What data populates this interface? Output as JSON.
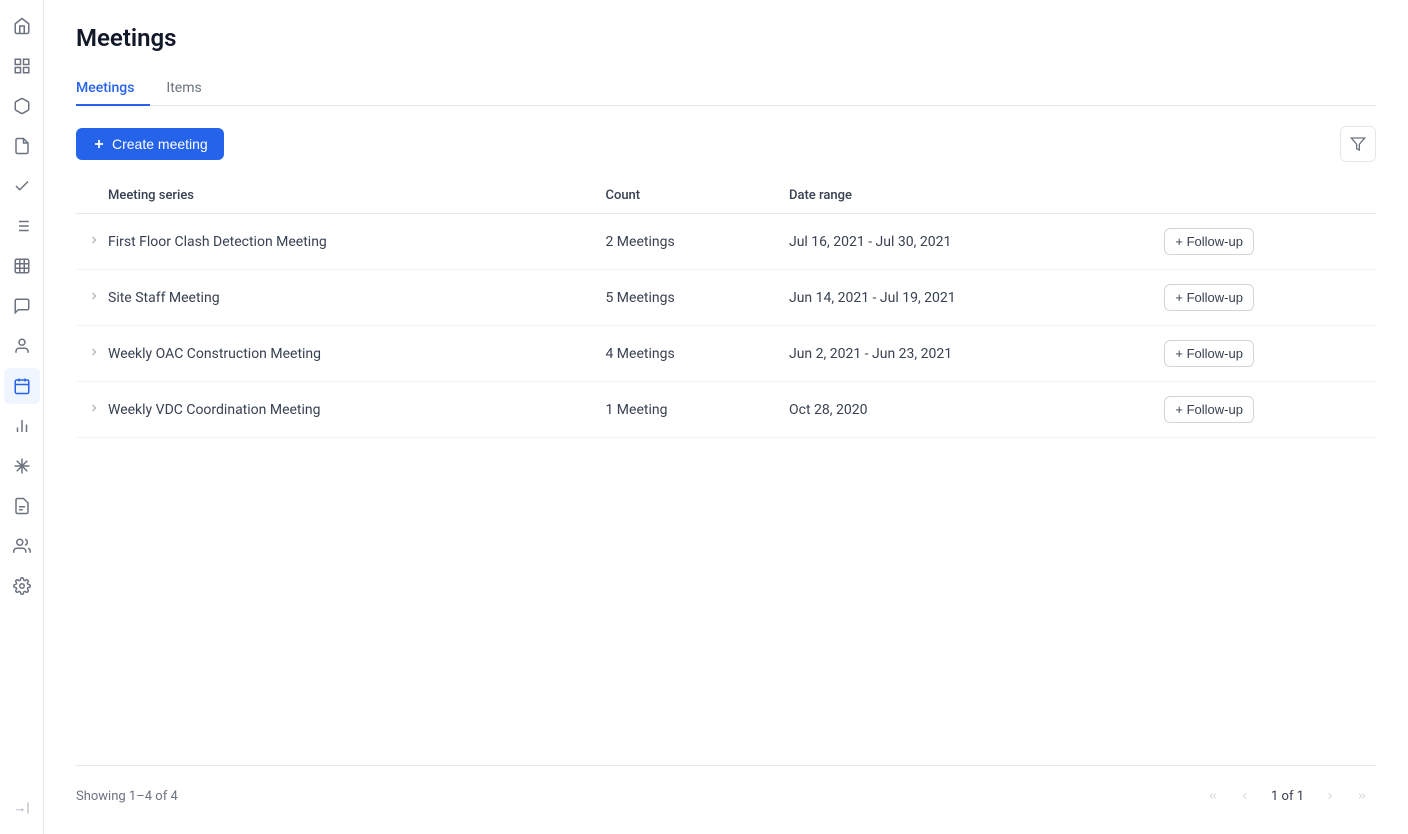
{
  "page": {
    "title": "Meetings"
  },
  "sidebar": {
    "icons": [
      {
        "name": "home-icon",
        "symbol": "⌂",
        "active": false
      },
      {
        "name": "grid-icon",
        "symbol": "⊞",
        "active": false
      },
      {
        "name": "box-icon",
        "symbol": "◻",
        "active": false
      },
      {
        "name": "document-icon",
        "symbol": "🗋",
        "active": false
      },
      {
        "name": "check-icon",
        "symbol": "✓",
        "active": false
      },
      {
        "name": "list-icon",
        "symbol": "☰",
        "active": false
      },
      {
        "name": "chart-icon",
        "symbol": "▦",
        "active": false
      },
      {
        "name": "comment-icon",
        "symbol": "💬",
        "active": false
      },
      {
        "name": "person-icon",
        "symbol": "👤",
        "active": false
      },
      {
        "name": "calendar-icon",
        "symbol": "📅",
        "active": true
      },
      {
        "name": "analytics-icon",
        "symbol": "📈",
        "active": false
      },
      {
        "name": "snowflake-icon",
        "symbol": "❄",
        "active": false
      },
      {
        "name": "reports-icon",
        "symbol": "📊",
        "active": false
      },
      {
        "name": "team-icon",
        "symbol": "👥",
        "active": false
      },
      {
        "name": "settings-icon",
        "symbol": "⚙",
        "active": false
      }
    ],
    "bottom_icon": {
      "name": "collapse-icon",
      "symbol": "→|"
    }
  },
  "tabs": [
    {
      "label": "Meetings",
      "active": true
    },
    {
      "label": "Items",
      "active": false
    }
  ],
  "toolbar": {
    "create_button_label": "Create meeting",
    "filter_button_label": "Filter"
  },
  "table": {
    "columns": [
      {
        "key": "name",
        "label": "Meeting series"
      },
      {
        "key": "count",
        "label": "Count"
      },
      {
        "key": "date_range",
        "label": "Date range"
      },
      {
        "key": "action",
        "label": ""
      }
    ],
    "rows": [
      {
        "name": "First Floor Clash Detection Meeting",
        "count": "2 Meetings",
        "date_range": "Jul 16, 2021 - Jul 30, 2021",
        "follow_up_label": "+ Follow-up"
      },
      {
        "name": "Site Staff Meeting",
        "count": "5 Meetings",
        "date_range": "Jun 14, 2021 - Jul 19, 2021",
        "follow_up_label": "+ Follow-up"
      },
      {
        "name": "Weekly OAC Construction Meeting",
        "count": "4 Meetings",
        "date_range": "Jun 2, 2021 - Jun 23, 2021",
        "follow_up_label": "+ Follow-up"
      },
      {
        "name": "Weekly VDC Coordination Meeting",
        "count": "1 Meeting",
        "date_range": "Oct 28, 2020",
        "follow_up_label": "+ Follow-up"
      }
    ]
  },
  "pagination": {
    "showing_text": "Showing 1–4 of 4",
    "page_indicator": "1 of 1"
  }
}
